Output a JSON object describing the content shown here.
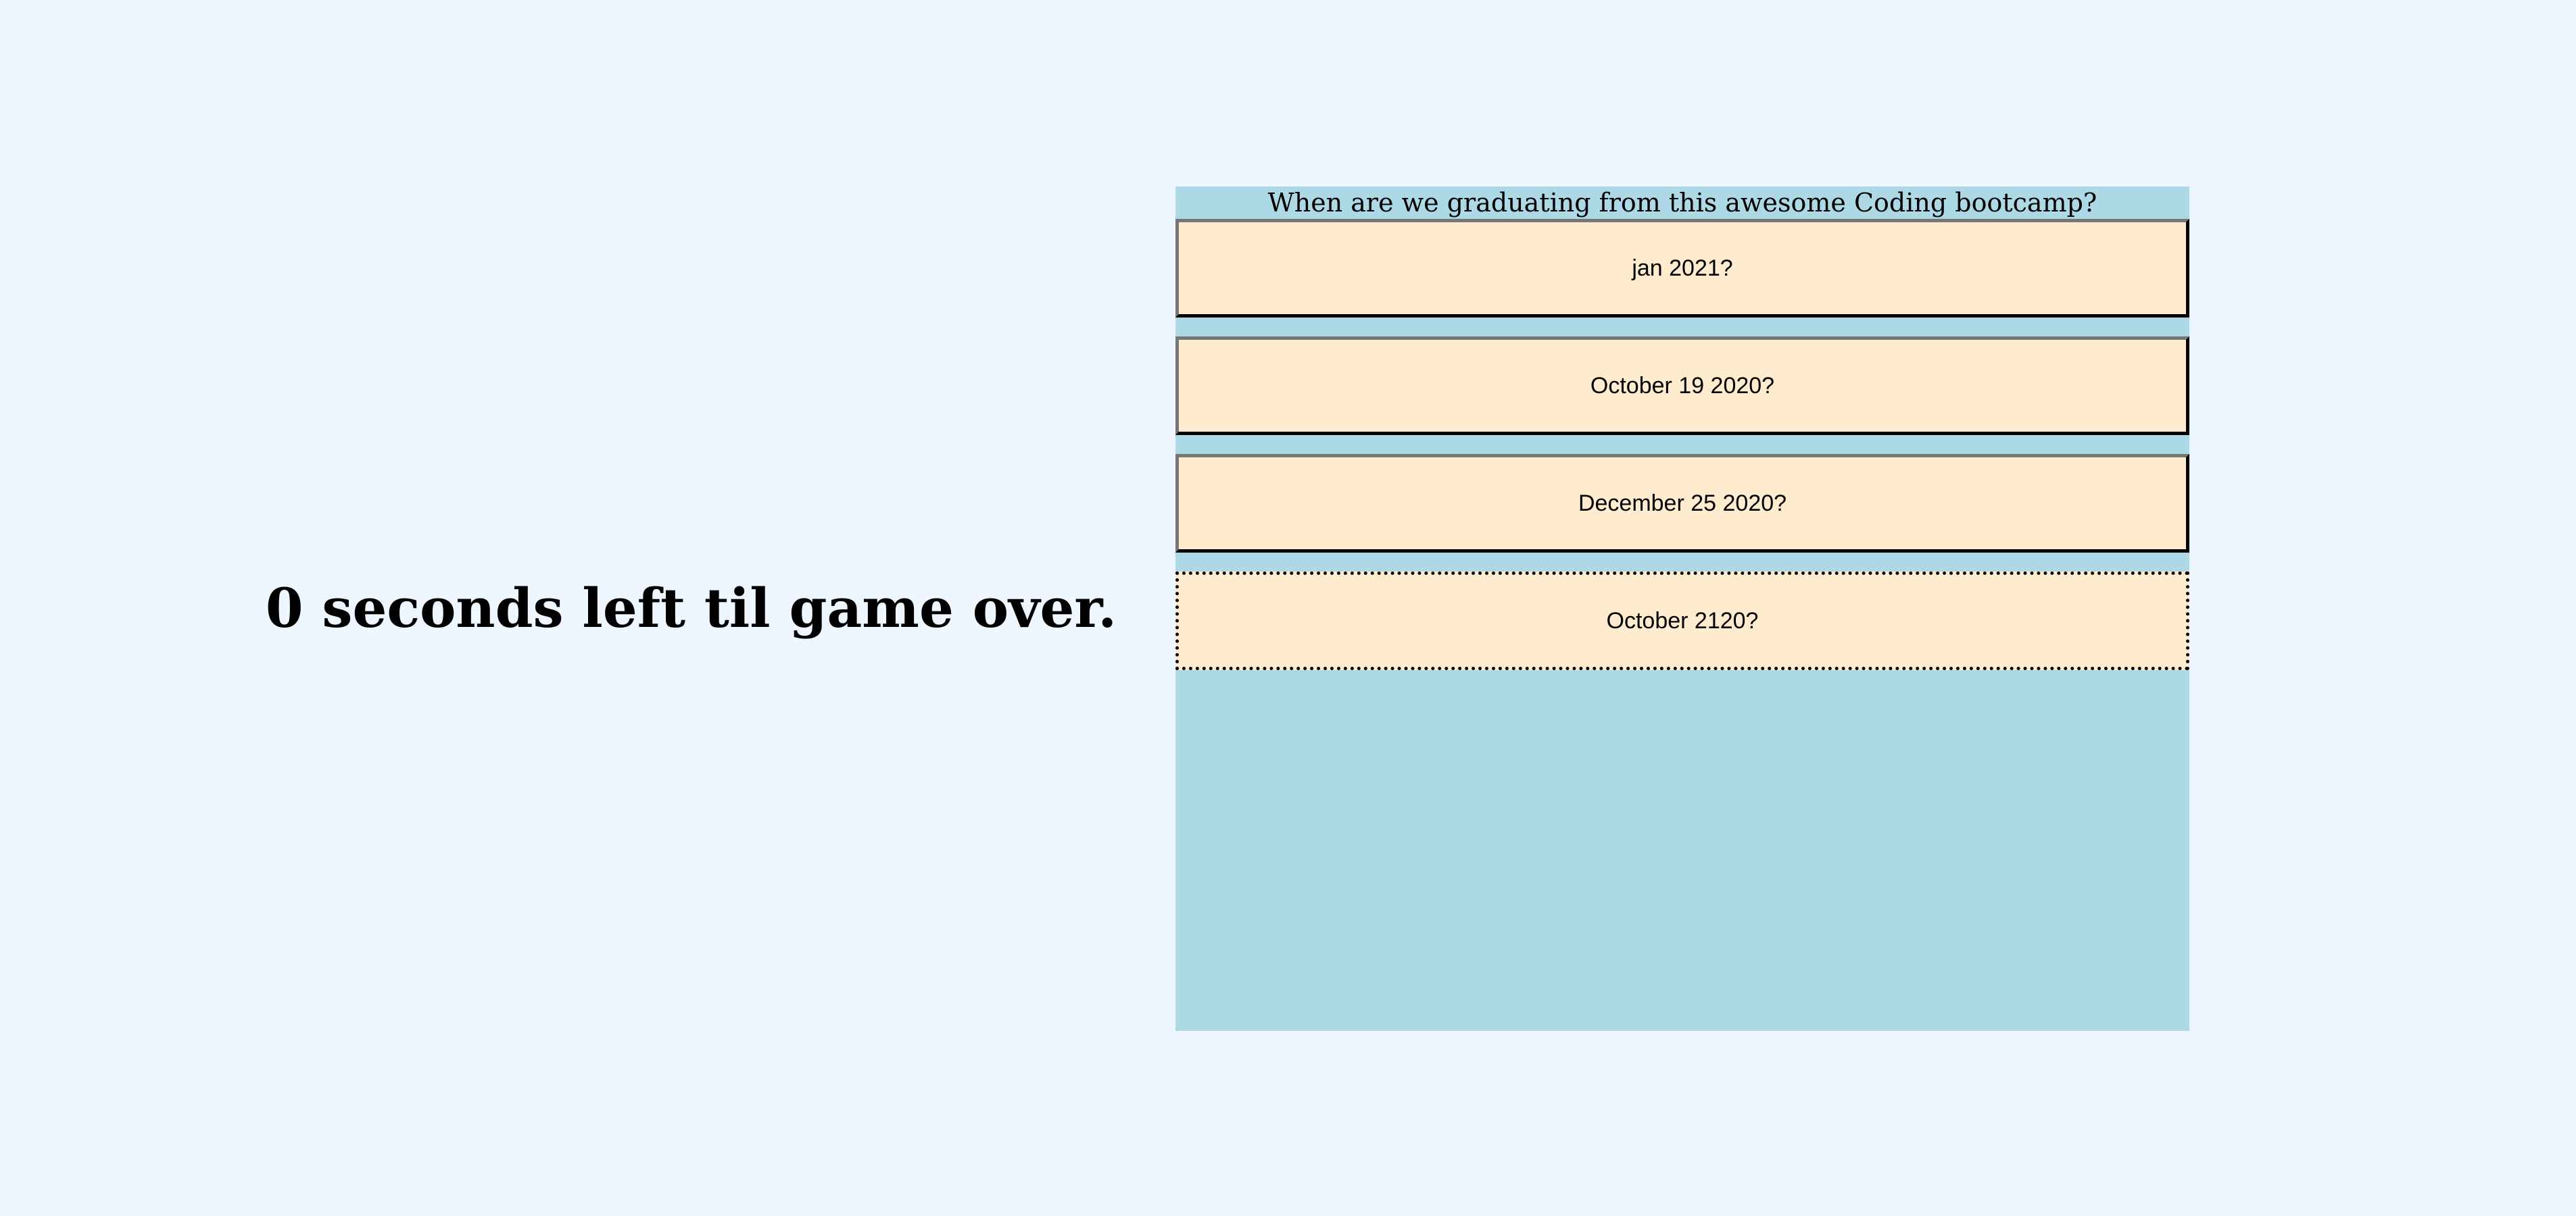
{
  "timer": {
    "text": "0 seconds left til game over."
  },
  "quiz": {
    "question": "When are we graduating from this awesome Coding bootcamp?",
    "answers": [
      {
        "label": "jan 2021?"
      },
      {
        "label": "October 19 2020?"
      },
      {
        "label": "December 25 2020?"
      },
      {
        "label": "October 2120?"
      }
    ]
  },
  "colors": {
    "page_background": "#eef6ff",
    "quiz_background": "#add8e6",
    "answer_background": "#ffebcd"
  }
}
